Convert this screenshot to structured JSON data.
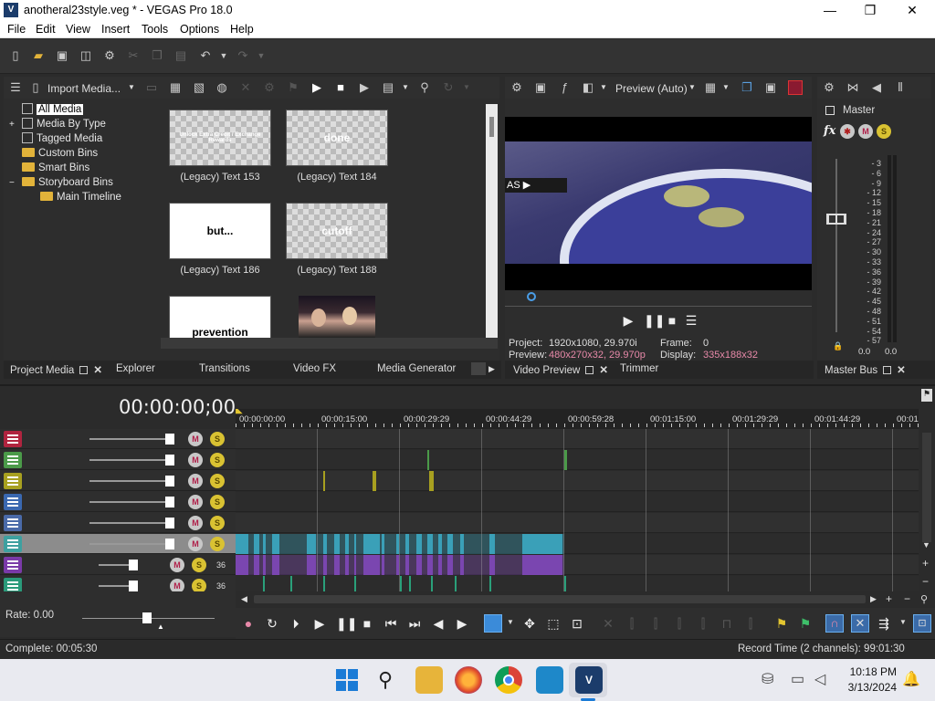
{
  "window": {
    "title": "anotheral23style.veg * - VEGAS Pro 18.0",
    "app_icon_text": "V",
    "controls": {
      "minimize": "—",
      "maximize": "❐",
      "close": "✕"
    }
  },
  "menu": [
    "File",
    "Edit",
    "View",
    "Insert",
    "Tools",
    "Options",
    "Help"
  ],
  "project_media": {
    "import_label": "Import Media...",
    "tree": [
      {
        "label": "All Media",
        "icon": "doc",
        "indent": 0,
        "selected": true
      },
      {
        "label": "Media By Type",
        "icon": "doc",
        "indent": 0,
        "expander": "+"
      },
      {
        "label": "Tagged Media",
        "icon": "doc",
        "indent": 0
      },
      {
        "label": "Custom Bins",
        "icon": "folder",
        "indent": 0
      },
      {
        "label": "Smart Bins",
        "icon": "folder",
        "indent": 0
      },
      {
        "label": "Storyboard Bins",
        "icon": "folder",
        "indent": 0,
        "expander": "−"
      },
      {
        "label": "Main Timeline",
        "icon": "folder",
        "indent": 1
      }
    ],
    "thumbnails": [
      {
        "label": "(Legacy) Text 153",
        "text": "Unlock Extra Credit / Exchange Rewards",
        "style": "checker"
      },
      {
        "label": "(Legacy) Text 184",
        "text": "done",
        "style": "checker"
      },
      {
        "label": "(Legacy) Text 186",
        "text": "but...",
        "style": "white"
      },
      {
        "label": "(Legacy) Text 188",
        "text": "cutoff",
        "style": "checker"
      },
      {
        "label": "",
        "text": "prevention",
        "style": "white"
      },
      {
        "label": "",
        "text": "",
        "style": "photo"
      }
    ],
    "tabs": [
      "Project Media",
      "Explorer",
      "Transitions",
      "Video FX",
      "Media Generator"
    ]
  },
  "preview": {
    "mode": "Preview (Auto)",
    "overlay_text": "AS ▶",
    "project_label": "Project:",
    "project_value": "1920x1080, 29.970i",
    "preview_label": "Preview:",
    "preview_value": "480x270x32, 29.970p",
    "frame_label": "Frame:",
    "frame_value": "0",
    "display_label": "Display:",
    "display_value": "335x188x32",
    "tabs": [
      "Video Preview",
      "Trimmer"
    ]
  },
  "master": {
    "label": "Master",
    "fx": "fx",
    "scale": [
      "3",
      "6",
      "9",
      "12",
      "15",
      "18",
      "21",
      "24",
      "27",
      "30",
      "33",
      "36",
      "39",
      "42",
      "45",
      "48",
      "51",
      "54",
      "57"
    ],
    "left_value": "0.0",
    "right_value": "0.0",
    "tab": "Master Bus"
  },
  "timeline": {
    "timecode": "00:00:00;00",
    "ruler": [
      "00:00:00:00",
      "00:00:15:00",
      "00:00:29:29",
      "00:00:44:29",
      "00:00:59:28",
      "00:01:15:00",
      "00:01:29:29",
      "00:01:44:29",
      "00:01"
    ],
    "tracks": [
      {
        "color": "#b0243f",
        "selected": false,
        "slider": 0.9,
        "extra": ""
      },
      {
        "color": "#4b9a49",
        "selected": false,
        "slider": 0.9,
        "extra": ""
      },
      {
        "color": "#a8a020",
        "selected": false,
        "slider": 0.9,
        "extra": ""
      },
      {
        "color": "#3a68b0",
        "selected": false,
        "slider": 0.9,
        "extra": ""
      },
      {
        "color": "#4a6aa8",
        "selected": false,
        "slider": 0.9,
        "extra": ""
      },
      {
        "color": "#3ea0a0",
        "selected": true,
        "slider": 0.9,
        "extra": ""
      },
      {
        "color": "#7a3aa8",
        "selected": false,
        "slider": 0.5,
        "extra": "36"
      },
      {
        "color": "#2a9a7a",
        "selected": false,
        "slider": 0.5,
        "extra": "36"
      }
    ],
    "rate_label": "Rate: 0.00"
  },
  "status": {
    "left": "Complete: 00:05:30",
    "right": "Record Time (2 channels): 99:01:30"
  },
  "taskbar": {
    "time": "10:18 PM",
    "date": "3/13/2024"
  }
}
